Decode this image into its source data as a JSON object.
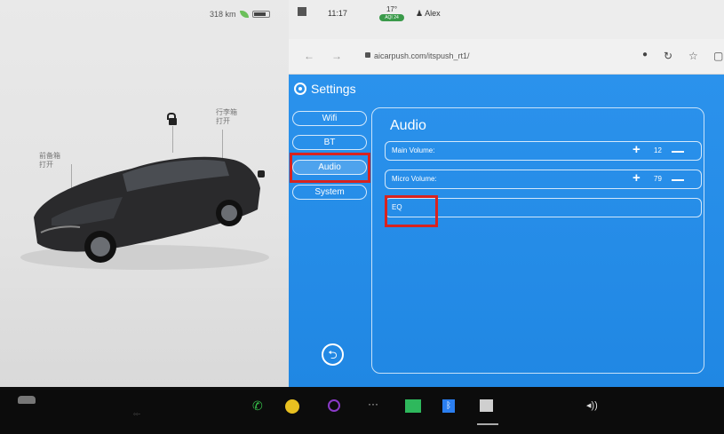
{
  "status": {
    "range": "318 km",
    "time": "11:17",
    "temperature": "17°",
    "aqi": "AQI 24",
    "user": "Alex"
  },
  "browser": {
    "url": "aicarpush.com/itspush_rt1/"
  },
  "car_panel": {
    "trunk_label_line1": "行李箱",
    "trunk_label_line2": "打开",
    "frunk_label_line1": "前备箱",
    "frunk_label_line2": "打开"
  },
  "settings": {
    "title": "Settings",
    "nav": [
      {
        "label": "Wifi"
      },
      {
        "label": "BT"
      },
      {
        "label": "Audio"
      },
      {
        "label": "System"
      }
    ],
    "panel_title": "Audio",
    "rows": [
      {
        "label": "Main Volume:",
        "value": "12"
      },
      {
        "label": "Micro Volume:",
        "value": "79"
      },
      {
        "label": "EQ"
      }
    ]
  },
  "colors": {
    "accent_blue": "#2087e3",
    "highlight_red": "#d8231f"
  }
}
